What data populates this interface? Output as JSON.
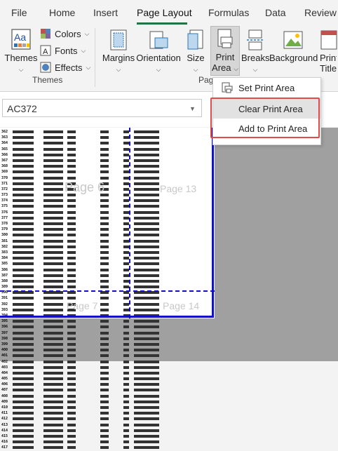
{
  "tabs": [
    "File",
    "Home",
    "Insert",
    "Page Layout",
    "Formulas",
    "Data",
    "Review"
  ],
  "active_tab": "Page Layout",
  "ribbon": {
    "themes_group": {
      "themes_label": "Themes",
      "colors_label": "Colors",
      "fonts_label": "Fonts",
      "effects_label": "Effects",
      "group_label": "Themes"
    },
    "page_setup": {
      "margins_label": "Margins",
      "orientation_label": "Orientation",
      "size_label": "Size",
      "print_area_line1": "Print",
      "print_area_line2": "Area",
      "breaks_label": "Breaks",
      "background_label": "Background",
      "print_titles_label": "Print Titles",
      "group_label_partial": "Pag"
    }
  },
  "namebox": {
    "value": "AC372"
  },
  "print_area_menu": {
    "items": [
      {
        "label": "Set Print Area",
        "state": "normal"
      },
      {
        "label": "Clear Print Area",
        "state": "hover"
      },
      {
        "label": "Add to Print Area",
        "state": "normal"
      }
    ]
  },
  "sheet": {
    "watermarks": [
      "Page 6",
      "Page 13",
      "Page 7",
      "Page 14"
    ],
    "row_numbers": [
      "362",
      "363",
      "364",
      "365",
      "366",
      "367",
      "368",
      "369",
      "370",
      "371",
      "372",
      "373",
      "374",
      "375",
      "376",
      "377",
      "378",
      "379",
      "380",
      "381",
      "382",
      "383",
      "384",
      "385",
      "386",
      "387",
      "388",
      "389",
      "390",
      "391",
      "392",
      "393",
      "394",
      "395",
      "396",
      "397",
      "398",
      "399",
      "400",
      "401",
      "402",
      "403",
      "404",
      "405",
      "406",
      "407",
      "408",
      "409",
      "410",
      "411",
      "412",
      "413",
      "414",
      "415",
      "416",
      "417"
    ]
  },
  "colors": {
    "accent": "#217346",
    "page_break": "#1010c8",
    "highlight": "#e24a4a",
    "grid_bg": "#a0a0a0"
  }
}
